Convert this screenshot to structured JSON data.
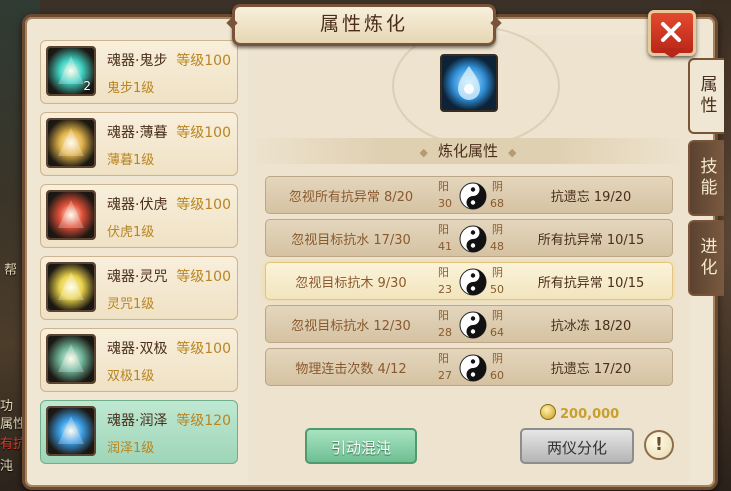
{
  "window": {
    "title": "属性炼化"
  },
  "tabs": [
    {
      "label": "属性",
      "active": true
    },
    {
      "label": "技能",
      "active": false
    },
    {
      "label": "进化",
      "active": false
    }
  ],
  "side_hud": {
    "texts": [
      "帮",
      "功",
      "属性",
      "有抗",
      "沌"
    ]
  },
  "souls": [
    {
      "name": "魂器·鬼步",
      "level": "等级100",
      "sub": "鬼步1级",
      "count": "2",
      "icon": "ghost-step-icon",
      "color": "#3fd1c2"
    },
    {
      "name": "魂器·薄暮",
      "level": "等级100",
      "sub": "薄暮1级",
      "count": "",
      "icon": "twilight-icon",
      "color": "#e2b34a"
    },
    {
      "name": "魂器·伏虎",
      "level": "等级100",
      "sub": "伏虎1级",
      "count": "",
      "icon": "tiger-icon",
      "color": "#e2513a"
    },
    {
      "name": "魂器·灵咒",
      "level": "等级100",
      "sub": "灵咒1级",
      "count": "",
      "icon": "spirit-curse-icon",
      "color": "#e8d24a"
    },
    {
      "name": "魂器·双极",
      "level": "等级100",
      "sub": "双极1级",
      "count": "",
      "icon": "dual-pole-icon",
      "color": "#6fb59a"
    },
    {
      "name": "魂器·润泽",
      "level": "等级120",
      "sub": "润泽1级",
      "count": "",
      "icon": "moisture-icon",
      "color": "#3a9ee8",
      "selected": true
    }
  ],
  "refine": {
    "section_title": "炼化属性",
    "yang_label": "阳",
    "yin_label": "阴",
    "rows": [
      {
        "left": "忽视所有抗异常 8/20",
        "yang": "30",
        "yin": "68",
        "right": "抗遗忘 19/20",
        "highlight": false
      },
      {
        "left": "忽视目标抗水 17/30",
        "yang": "41",
        "yin": "48",
        "right": "所有抗异常 10/15",
        "highlight": false
      },
      {
        "left": "忽视目标抗木 9/30",
        "yang": "23",
        "yin": "50",
        "right": "所有抗异常 10/15",
        "highlight": true
      },
      {
        "left": "忽视目标抗水 12/30",
        "yang": "28",
        "yin": "64",
        "right": "抗冰冻 18/20",
        "highlight": false
      },
      {
        "left": "物理连击次数 4/12",
        "yang": "27",
        "yin": "60",
        "right": "抗遗忘 17/20",
        "highlight": false
      }
    ]
  },
  "cost": {
    "amount": "200,000"
  },
  "buttons": {
    "chaos": "引动混沌",
    "split": "两仪分化",
    "info": "!"
  },
  "colors": {
    "accent": "#6b4a31",
    "gold": "#b88520",
    "selected": "#9ed5b8"
  }
}
